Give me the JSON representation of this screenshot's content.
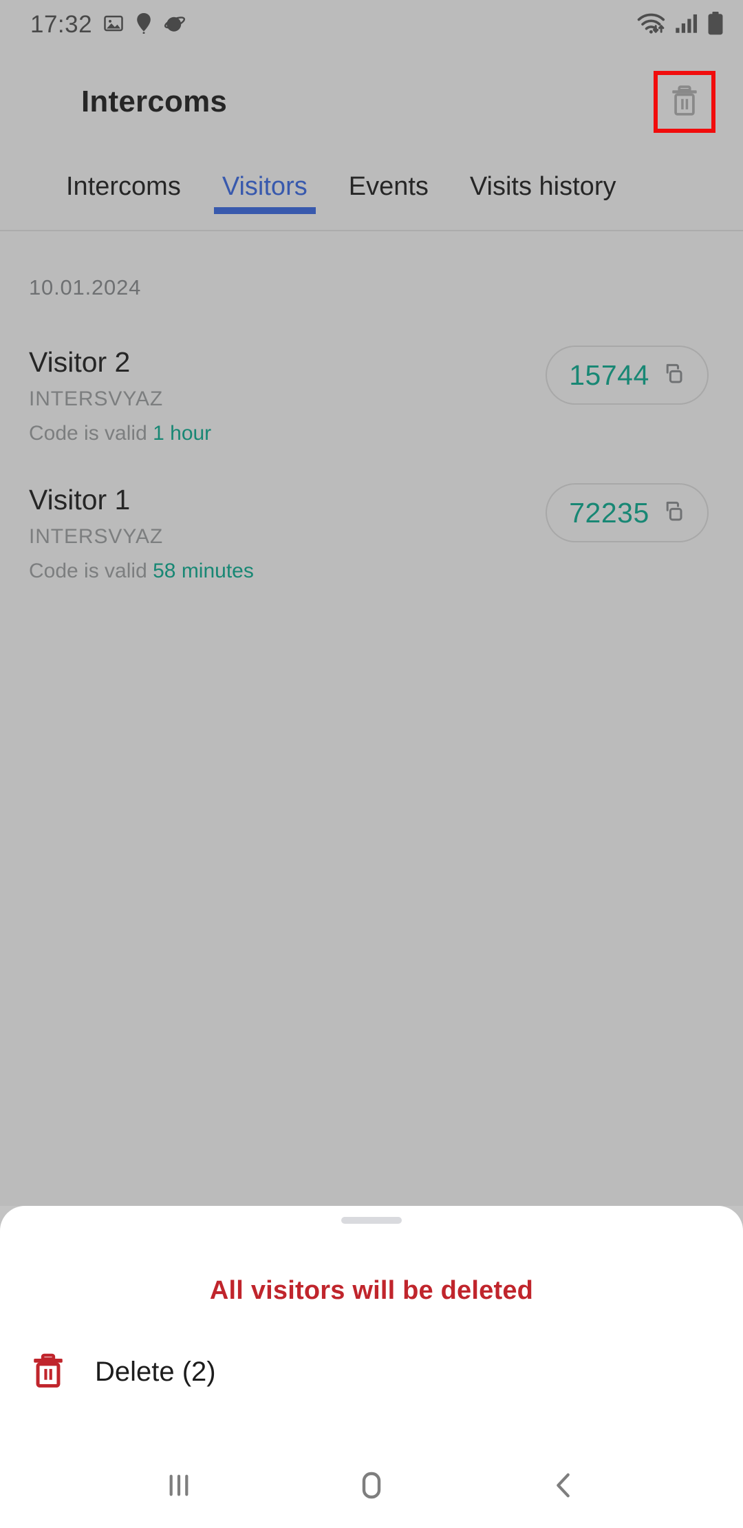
{
  "status_bar": {
    "time": "17:32",
    "left_icons": [
      "image-icon",
      "location-pin-icon",
      "planet-icon"
    ],
    "right_icons": [
      "wifi-icon",
      "cellular-signal-icon",
      "battery-icon"
    ]
  },
  "app_bar": {
    "title": "Intercoms",
    "delete_all_icon": "trash-icon",
    "highlight_color": "#ff0000"
  },
  "tabs": {
    "active_index": 1,
    "accent_color": "#3256b4",
    "items": [
      {
        "label": "Intercoms"
      },
      {
        "label": "Visitors"
      },
      {
        "label": "Events"
      },
      {
        "label": "Visits history"
      }
    ]
  },
  "content": {
    "date_header": "10.01.2024",
    "valid_label": "Code is valid",
    "code_color": "#0e8a74",
    "copy_icon": "copy-icon",
    "visitors": [
      {
        "name": "Visitor 2",
        "org": "INTERSVYAZ",
        "valid_label": "Code is valid",
        "valid_time": "1 hour",
        "code": "15744"
      },
      {
        "name": "Visitor 1",
        "org": "INTERSVYAZ",
        "valid_label": "Code is valid",
        "valid_time": "58 minutes",
        "code": "72235"
      }
    ]
  },
  "bottom_sheet": {
    "warning": "All visitors will be deleted",
    "warning_color": "#c0252c",
    "delete_label": "Delete (2)",
    "delete_icon": "trash-icon"
  },
  "nav_bar": {
    "recents": "recents-icon",
    "home": "home-icon",
    "back": "back-icon"
  }
}
